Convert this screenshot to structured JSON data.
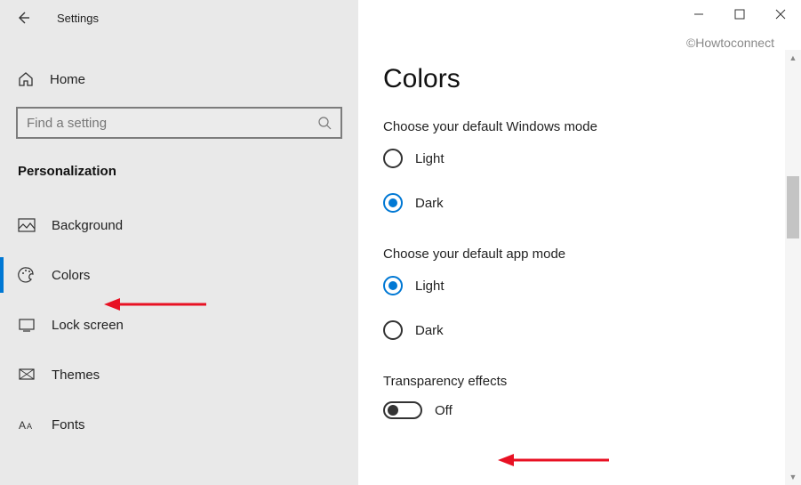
{
  "app_title": "Settings",
  "watermark": "©Howtoconnect",
  "sidebar": {
    "home_label": "Home",
    "search_placeholder": "Find a setting",
    "section_title": "Personalization",
    "items": [
      {
        "label": "Background"
      },
      {
        "label": "Colors"
      },
      {
        "label": "Lock screen"
      },
      {
        "label": "Themes"
      },
      {
        "label": "Fonts"
      }
    ]
  },
  "main": {
    "title": "Colors",
    "windows_mode": {
      "label": "Choose your default Windows mode",
      "light": "Light",
      "dark": "Dark",
      "selected": "Dark"
    },
    "app_mode": {
      "label": "Choose your default app mode",
      "light": "Light",
      "dark": "Dark",
      "selected": "Light"
    },
    "transparency": {
      "label": "Transparency effects",
      "state_label": "Off",
      "state": false
    }
  }
}
